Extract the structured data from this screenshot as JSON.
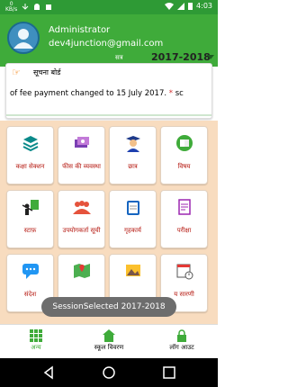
{
  "status": {
    "kb": "0",
    "kb_unit": "KB/s",
    "time": "4:03"
  },
  "profile": {
    "name": "Administrator",
    "email": "dev4junction@gmail.com"
  },
  "session": {
    "label": "सत्र",
    "value": "2017-2018"
  },
  "notice": {
    "title": "सूचना बोर्ड",
    "text_main": "of fee payment changed to 15 July 2017. ",
    "text_star": "*",
    "text_tail": " sc"
  },
  "tiles": [
    {
      "label": "कक्षा सेक्शन",
      "icon": "layers-icon"
    },
    {
      "label": "फीस की व्यवस्था",
      "icon": "money-icon"
    },
    {
      "label": "छात्र",
      "icon": "graduate-icon"
    },
    {
      "label": "विषय",
      "icon": "book-icon"
    },
    {
      "label": "स्टाफ़",
      "icon": "teacher-icon"
    },
    {
      "label": "उपयोगकर्ता सूची",
      "icon": "users-icon"
    },
    {
      "label": "गृहकार्य",
      "icon": "clipboard-icon"
    },
    {
      "label": "परीक्षा",
      "icon": "exam-icon"
    },
    {
      "label": "संदेश",
      "icon": "chat-icon"
    },
    {
      "label": "",
      "icon": "map-icon"
    },
    {
      "label": "",
      "icon": "gallery-icon"
    },
    {
      "label": "य सारणी",
      "icon": "calendar-icon"
    }
  ],
  "toast": "SessionSelected 2017-2018",
  "bottom_nav": {
    "items": [
      {
        "label": "अन्य",
        "icon": "grid-icon"
      },
      {
        "label": "स्कूल विवरण",
        "icon": "home-icon"
      },
      {
        "label": "लॉग आउट",
        "icon": "lock-icon"
      }
    ]
  },
  "colors": {
    "primary": "#3fab3a",
    "status": "#2e9a35",
    "label": "#b5170f",
    "grid_bg": "#f8dcbf"
  }
}
